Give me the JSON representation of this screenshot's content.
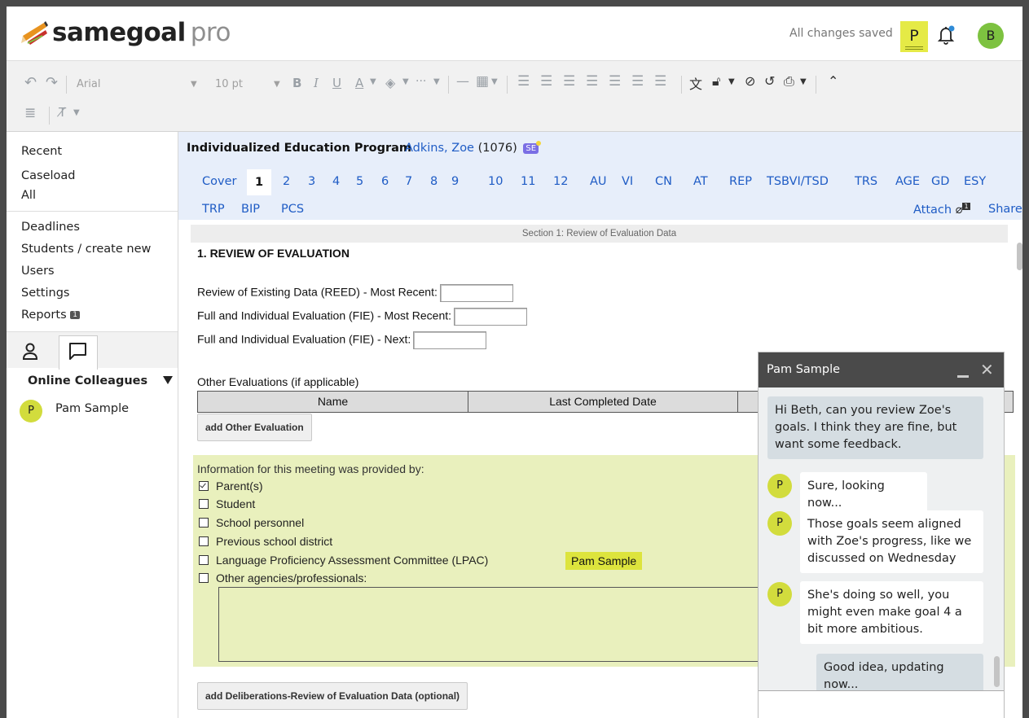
{
  "app": {
    "logo_bold": "samegoal",
    "logo_suffix": "pro",
    "saved_status": "All changes saved",
    "presence_initial": "P",
    "user_initial": "B"
  },
  "toolbar": {
    "font_family": "Arial",
    "font_size": "10 pt"
  },
  "sidebar": {
    "items_top": [
      "Recent",
      "Caseload",
      "All"
    ],
    "items_mid": [
      "Deadlines",
      "Students / create new",
      "Users",
      "Settings",
      "Reports"
    ],
    "reports_badge": "1",
    "colleagues_title": "Online Colleagues",
    "colleague_initial": "P",
    "colleague_name": "Pam Sample"
  },
  "doc": {
    "title": "Individualized Education Program",
    "student_name": "Adkins, Zoe",
    "student_id": "(1076)",
    "badge": "SE",
    "cover": "Cover",
    "active_section": "1",
    "sections_row1": [
      "2",
      "3",
      "4",
      "5",
      "6",
      "7",
      "8",
      "9",
      "10",
      "11",
      "12",
      "AU",
      "VI",
      "CN",
      "AT",
      "REP",
      "TSBVI/TSD",
      "TRS",
      "AGE",
      "GD",
      "ESY"
    ],
    "sections_row2": [
      "TRP",
      "BIP",
      "PCS"
    ],
    "attach_label": "Attach",
    "attach_count": "1",
    "share_label": "Share"
  },
  "section": {
    "bar_label": "Section 1: Review of Evaluation Data",
    "heading": "1. REVIEW OF EVALUATION",
    "field_reed": "Review of Existing Data (REED) - Most Recent:",
    "field_fie_recent": "Full and Individual Evaluation (FIE) - Most Recent:",
    "field_fie_next": "Full and Individual Evaluation (FIE) - Next:",
    "other_evals_label": "Other Evaluations (if applicable)",
    "col_name": "Name",
    "col_last_completed": "Last Completed Date",
    "add_other_eval": "add Other Evaluation",
    "info_title": "Information for this meeting was provided by:",
    "providers": [
      {
        "label": "Parent(s)",
        "checked": true
      },
      {
        "label": "Student",
        "checked": false
      },
      {
        "label": "School personnel",
        "checked": false
      },
      {
        "label": "Previous school district",
        "checked": false
      },
      {
        "label": "Language Proficiency Assessment Committee (LPAC)",
        "checked": false
      },
      {
        "label": "Other agencies/professionals:",
        "checked": false
      }
    ],
    "cursor_tag": "Pam Sample",
    "add_deliberations": "add Deliberations-Review of Evaluation Data (optional)"
  },
  "chat": {
    "title": "Pam Sample",
    "messages": [
      {
        "from": "me",
        "text": "Hi Beth, can you review Zoe's goals. I think they are fine, but want some feedback."
      },
      {
        "from": "P",
        "text": "Sure, looking now..."
      },
      {
        "from": "P",
        "text": "Those goals seem aligned with Zoe's progress, like we discussed on Wednesday"
      },
      {
        "from": "P",
        "text": "She's doing so well, you might even make goal 4 a bit more ambitious."
      },
      {
        "from": "me",
        "text": "Good idea, updating now..."
      }
    ]
  }
}
